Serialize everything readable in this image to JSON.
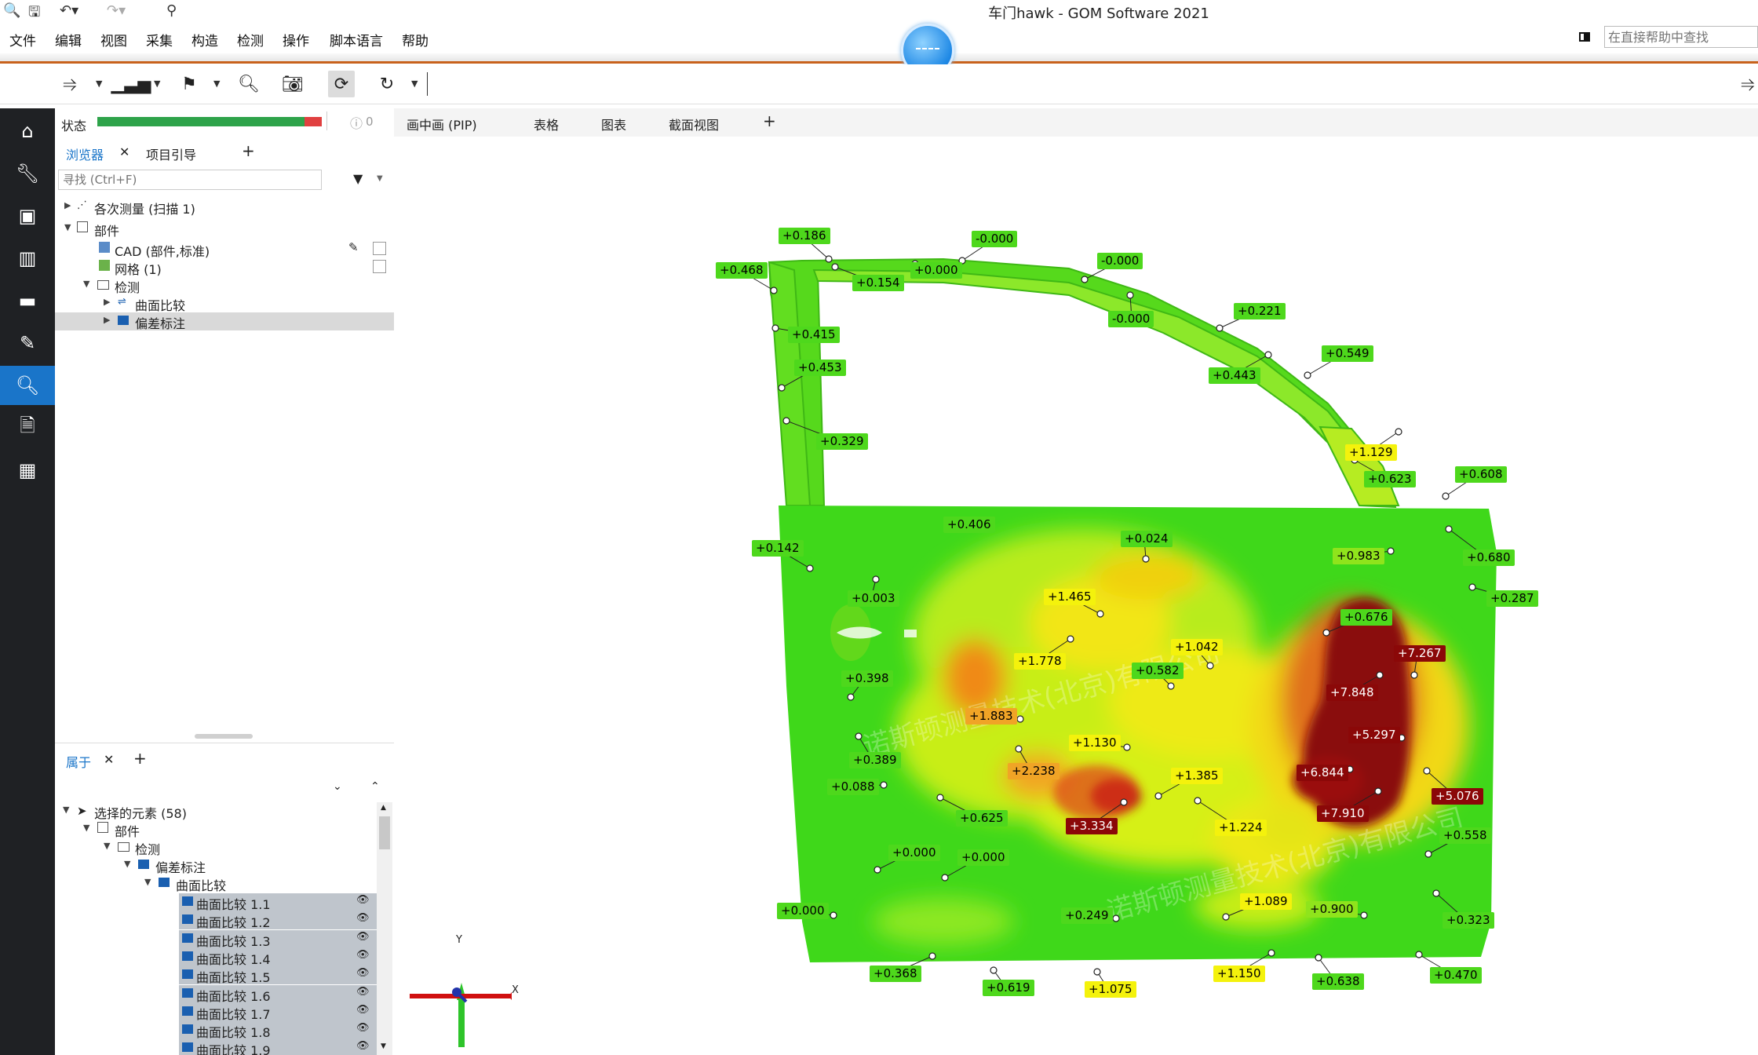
{
  "window": {
    "title": "车门hawk - GOM Software 2021"
  },
  "menu": [
    "文件",
    "编辑",
    "视图",
    "采集",
    "构造",
    "检测",
    "操作",
    "脚本语言",
    "帮助"
  ],
  "help_search": {
    "placeholder": "在直接帮助中查找"
  },
  "panel": {
    "status_label": "状态",
    "info_count": "0",
    "tabs": {
      "browser": "浏览器",
      "project": "项目引导"
    },
    "search_placeholder": "寻找 (Ctrl+F)",
    "tree": [
      {
        "label": "各次测量 (扫描 1)",
        "level": 0
      },
      {
        "label": "部件",
        "level": 0
      },
      {
        "label": "CAD (部件,标准)",
        "level": 1
      },
      {
        "label": "网格 (1)",
        "level": 1
      },
      {
        "label": "检测",
        "level": 1
      },
      {
        "label": "曲面比较",
        "level": 2
      },
      {
        "label": "偏差标注",
        "level": 2
      }
    ],
    "props_tab": "属于",
    "props_tree": [
      {
        "label": "选择的元素 (58)"
      },
      {
        "label": "部件"
      },
      {
        "label": "检测"
      },
      {
        "label": "偏差标注"
      },
      {
        "label": "曲面比较"
      }
    ],
    "comparisons": [
      "曲面比较 1.1",
      "曲面比较 1.2",
      "曲面比较 1.3",
      "曲面比较 1.4",
      "曲面比较 1.5",
      "曲面比较 1.6",
      "曲面比较 1.7",
      "曲面比较 1.8",
      "曲面比较 1.9"
    ]
  },
  "view_tabs": [
    "画中画 (PIP)",
    "表格",
    "图表",
    "截面视图"
  ],
  "deviation_labels": [
    {
      "text": "+0.186",
      "c": "g"
    },
    {
      "text": "-0.000",
      "c": "g"
    },
    {
      "text": "-0.000",
      "c": "g"
    },
    {
      "text": "+0.468",
      "c": "g"
    },
    {
      "text": "+0.154",
      "c": "g"
    },
    {
      "text": "+0.000",
      "c": "g"
    },
    {
      "text": "-0.000",
      "c": "g"
    },
    {
      "text": "+0.221",
      "c": "g"
    },
    {
      "text": "+0.415",
      "c": "g"
    },
    {
      "text": "+0.549",
      "c": "g"
    },
    {
      "text": "+0.453",
      "c": "g"
    },
    {
      "text": "+0.443",
      "c": "g"
    },
    {
      "text": "+0.329",
      "c": "g"
    },
    {
      "text": "+1.129",
      "c": "y"
    },
    {
      "text": "+0.623",
      "c": "g"
    },
    {
      "text": "+0.608",
      "c": "g"
    },
    {
      "text": "+0.406",
      "c": "g"
    },
    {
      "text": "+0.024",
      "c": "g"
    },
    {
      "text": "+0.142",
      "c": "g"
    },
    {
      "text": "+0.983",
      "c": "lg"
    },
    {
      "text": "+0.680",
      "c": "g"
    },
    {
      "text": "+0.003",
      "c": "g"
    },
    {
      "text": "+1.465",
      "c": "y"
    },
    {
      "text": "+0.287",
      "c": "g"
    },
    {
      "text": "+0.676",
      "c": "g"
    },
    {
      "text": "+7.267",
      "c": "r"
    },
    {
      "text": "+1.042",
      "c": "y"
    },
    {
      "text": "+1.778",
      "c": "y"
    },
    {
      "text": "+0.582",
      "c": "g"
    },
    {
      "text": "+0.398",
      "c": "g"
    },
    {
      "text": "+7.848",
      "c": "r"
    },
    {
      "text": "+1.883",
      "c": "o"
    },
    {
      "text": "+5.297",
      "c": "r"
    },
    {
      "text": "+1.130",
      "c": "y"
    },
    {
      "text": "+0.389",
      "c": "g"
    },
    {
      "text": "+2.238",
      "c": "o"
    },
    {
      "text": "+6.844",
      "c": "r"
    },
    {
      "text": "+1.385",
      "c": "y"
    },
    {
      "text": "+0.088",
      "c": "g"
    },
    {
      "text": "+7.910",
      "c": "r"
    },
    {
      "text": "+5.076",
      "c": "r"
    },
    {
      "text": "+0.625",
      "c": "g"
    },
    {
      "text": "+3.334",
      "c": "r"
    },
    {
      "text": "+1.224",
      "c": "y"
    },
    {
      "text": "+0.558",
      "c": "g"
    },
    {
      "text": "+0.000",
      "c": "g"
    },
    {
      "text": "+0.000",
      "c": "g"
    },
    {
      "text": "+1.089",
      "c": "y"
    },
    {
      "text": "+0.900",
      "c": "lg"
    },
    {
      "text": "+0.000",
      "c": "g"
    },
    {
      "text": "+0.249",
      "c": "g"
    },
    {
      "text": "+0.323",
      "c": "g"
    },
    {
      "text": "+0.368",
      "c": "g"
    },
    {
      "text": "+1.150",
      "c": "y"
    },
    {
      "text": "+0.638",
      "c": "g"
    },
    {
      "text": "+0.470",
      "c": "g"
    },
    {
      "text": "+0.619",
      "c": "g"
    },
    {
      "text": "+1.075",
      "c": "y"
    }
  ],
  "watermark": "诺斯顿测量技术(北京)有限公司",
  "axes": {
    "x": "X",
    "y": "Y"
  }
}
